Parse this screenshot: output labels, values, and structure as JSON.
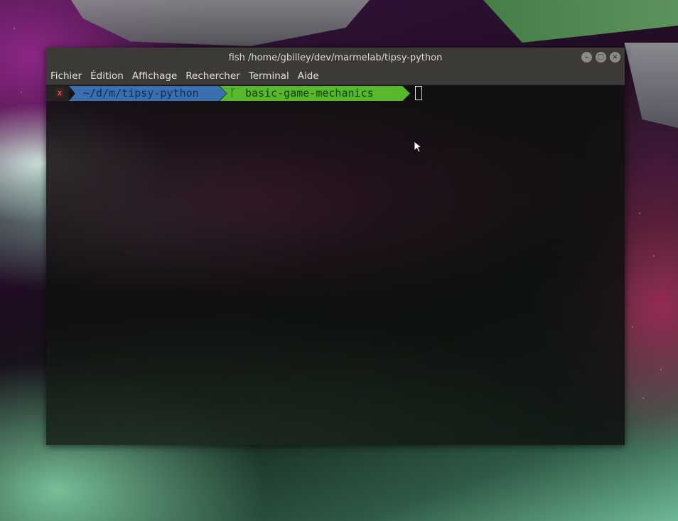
{
  "window": {
    "title": "fish  /home/gbilley/dev/marmelab/tipsy-python",
    "controls": {
      "minimize_icon": "–",
      "maximize_icon": "□",
      "close_icon": "×"
    }
  },
  "menubar": {
    "items": [
      "Fichier",
      "Édition",
      "Affichage",
      "Rechercher",
      "Terminal",
      "Aide"
    ]
  },
  "prompt": {
    "status_icon": "x",
    "path": "~/d/m/tipsy-python",
    "branch_icon": "ᚴ",
    "branch": "basic-game-mechanics"
  },
  "colors": {
    "path_segment": "#3b6fb0",
    "git_segment": "#58b82c",
    "status_error": "#e94b4b",
    "titlebar": "#3b3a36"
  }
}
